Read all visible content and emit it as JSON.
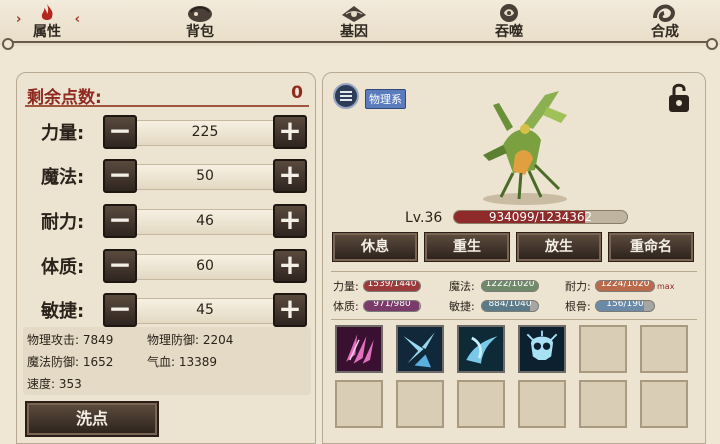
{
  "tabs": [
    {
      "label": "属性",
      "icon": "flame-icon",
      "active": true
    },
    {
      "label": "背包",
      "icon": "bag-icon",
      "active": false
    },
    {
      "label": "基因",
      "icon": "gene-icon",
      "active": false
    },
    {
      "label": "吞噬",
      "icon": "devour-icon",
      "active": false
    },
    {
      "label": "合成",
      "icon": "synthesis-icon",
      "active": false
    }
  ],
  "points": {
    "label": "剩余点数:",
    "value": "0"
  },
  "stats": [
    {
      "label": "力量:",
      "value": "225"
    },
    {
      "label": "魔法:",
      "value": "50"
    },
    {
      "label": "耐力:",
      "value": "46"
    },
    {
      "label": "体质:",
      "value": "60"
    },
    {
      "label": "敏捷:",
      "value": "45"
    }
  ],
  "derived": {
    "phys_attack": "物理攻击: 7849",
    "phys_defense": "物理防御: 2204",
    "magic_defense": "魔法防御: 1652",
    "hp": "气血: 13389",
    "speed": "速度: 353"
  },
  "reset_label": "洗点",
  "pet": {
    "type_label": "物理系",
    "level": "Lv.36",
    "hp_text": "934099/1234362",
    "hp_fraction": 0.757
  },
  "actions": [
    "休息",
    "重生",
    "放生",
    "重命名"
  ],
  "attributes": [
    {
      "label": "力量:",
      "text": "1539/1440",
      "fraction": 1.0,
      "color": "#9b3a3a",
      "max": ""
    },
    {
      "label": "魔法:",
      "text": "1222/1020",
      "fraction": 1.0,
      "color": "#6f8a6a",
      "max": ""
    },
    {
      "label": "耐力:",
      "text": "1224/1020",
      "fraction": 1.0,
      "color": "#b96a4a",
      "max": "max"
    },
    {
      "label": "体质:",
      "text": "971/980",
      "fraction": 0.99,
      "color": "#7a3a6a",
      "max": ""
    },
    {
      "label": "敏捷:",
      "text": "884/1040",
      "fraction": 0.85,
      "color": "#5a7a8a",
      "max": ""
    },
    {
      "label": "根骨:",
      "text": "156/190",
      "fraction": 0.82,
      "color": "#6a8aa8",
      "max": ""
    }
  ],
  "skills": [
    "claw-skill-icon",
    "ice-shard-skill-icon",
    "whirlwind-skill-icon",
    "frost-skull-skill-icon"
  ],
  "colors": {
    "accent": "#8e2a20",
    "panel": "#ece3d0",
    "button": "#2e241d"
  }
}
